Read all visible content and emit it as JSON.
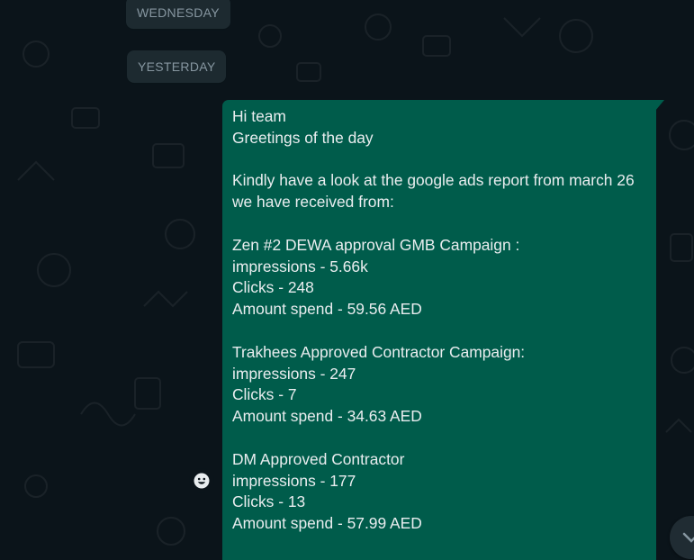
{
  "chat": {
    "date_chips": {
      "wednesday": "WEDNESDAY",
      "yesterday": "YESTERDAY"
    },
    "message": {
      "text": "Hi team\nGreetings of the day\n\nKindly have a look at the google ads report from march 26\nwe have received from:\n\nZen #2 DEWA approval GMB Campaign :\nimpressions - 5.66k\nClicks - 248\nAmount spend - 59.56 AED\n\nTrakhees Approved Contractor Campaign:\nimpressions - 247\nClicks - 7\nAmount spend - 34.63 AED\n\nDM Approved Contractor\nimpressions - 177\nClicks - 13\nAmount spend - 57.99 AED"
    },
    "icons": {
      "reaction": "smiley-icon",
      "scroll": "chevron-down-icon"
    }
  },
  "colors": {
    "background": "#0b141a",
    "outgoing_bubble": "#005c4b",
    "chip_bg": "#1d2a30",
    "chip_text": "#8696a0",
    "message_text": "#e9edef"
  }
}
